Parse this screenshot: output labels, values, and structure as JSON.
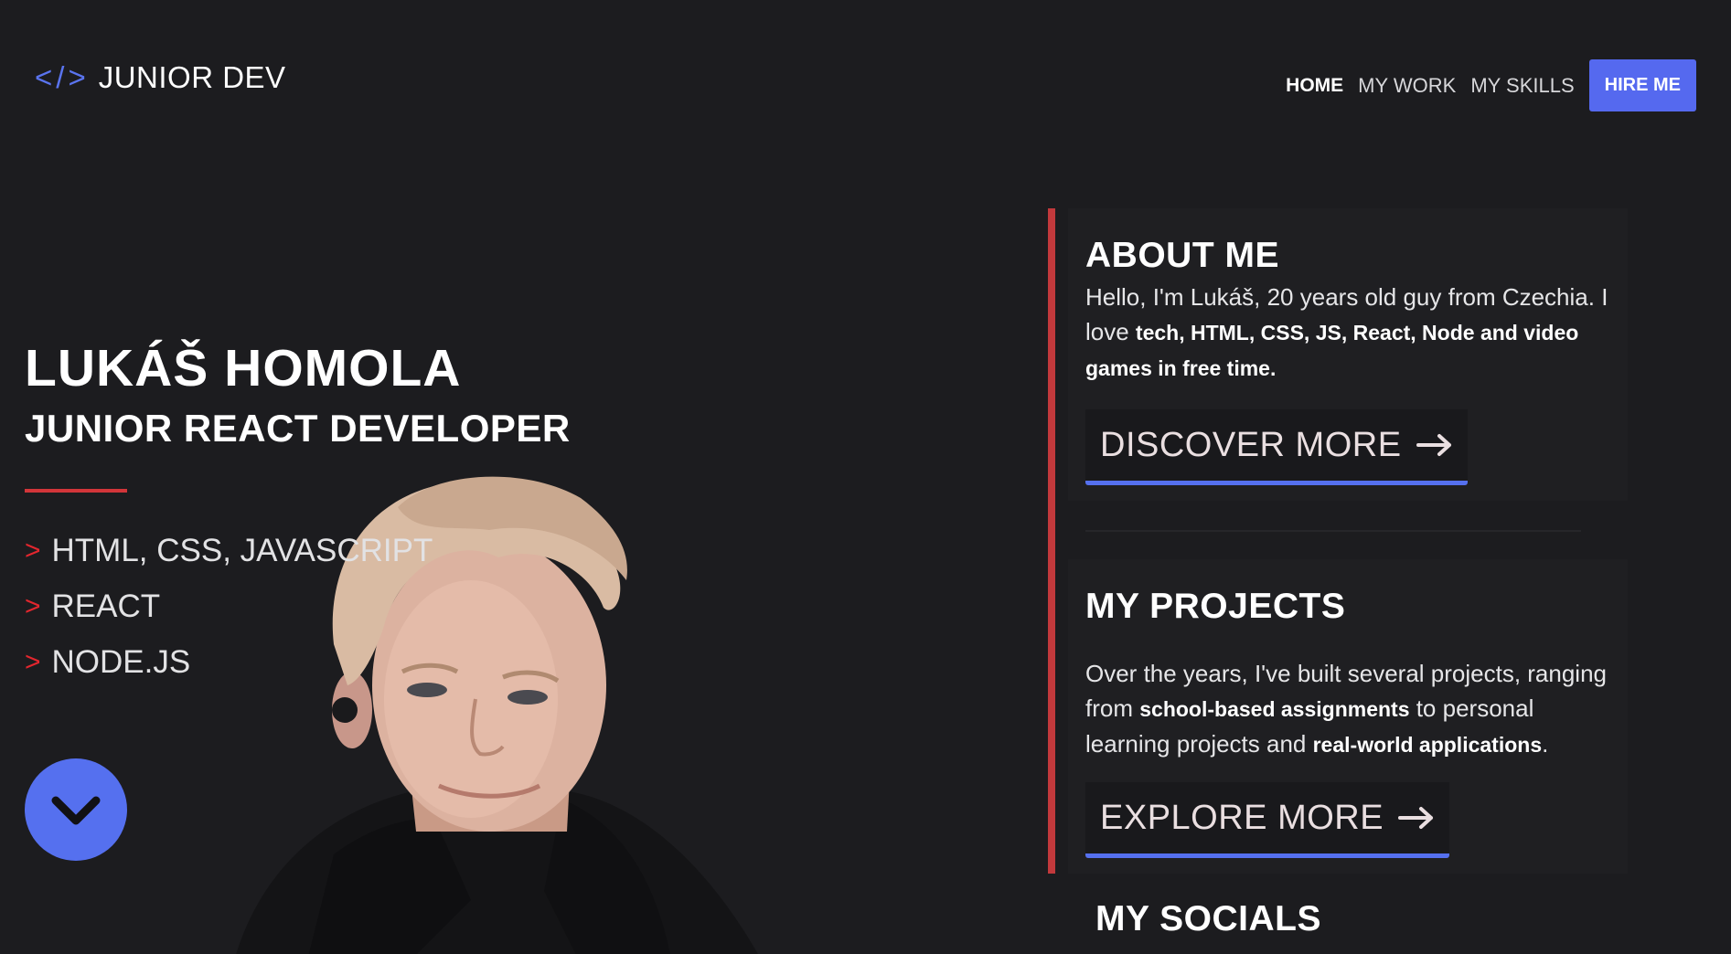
{
  "header": {
    "logo_code": "</>",
    "logo_name": "JUNIOR DEV",
    "nav": {
      "home": "HOME",
      "my_work": "MY WORK",
      "my_skills": "MY SKILLS",
      "hire_me": "HIRE ME"
    }
  },
  "hero": {
    "name": "LUKÁŠ HOMOLA",
    "role": "JUNIOR REACT DEVELOPER",
    "skill_marker": ">",
    "skills": [
      "HTML, CSS, JAVASCRIPT",
      "REACT",
      "NODE.JS"
    ]
  },
  "about": {
    "title": "ABOUT ME",
    "text_plain": "Hello, I'm Lukáš, 20 years old guy from Czechia. I love ",
    "text_bold": "tech, HTML, CSS, JS, React, Node and video games in free time.",
    "cta": "DISCOVER MORE"
  },
  "projects": {
    "title": "MY PROJECTS",
    "text_1": "Over the years, I've built several projects, ranging from ",
    "text_bold_1": "school-based assignments",
    "text_2": " to personal learning projects and ",
    "text_bold_2": "real-world applications",
    "text_3": ".",
    "cta": "EXPLORE MORE"
  },
  "socials": {
    "title": "MY SOCIALS"
  },
  "colors": {
    "background": "#1c1c1f",
    "accent_blue": "#5570ef",
    "accent_red": "#d23539"
  },
  "icons": {
    "scroll": "chevron-down-icon",
    "cta_arrow": "arrow-right-icon"
  }
}
